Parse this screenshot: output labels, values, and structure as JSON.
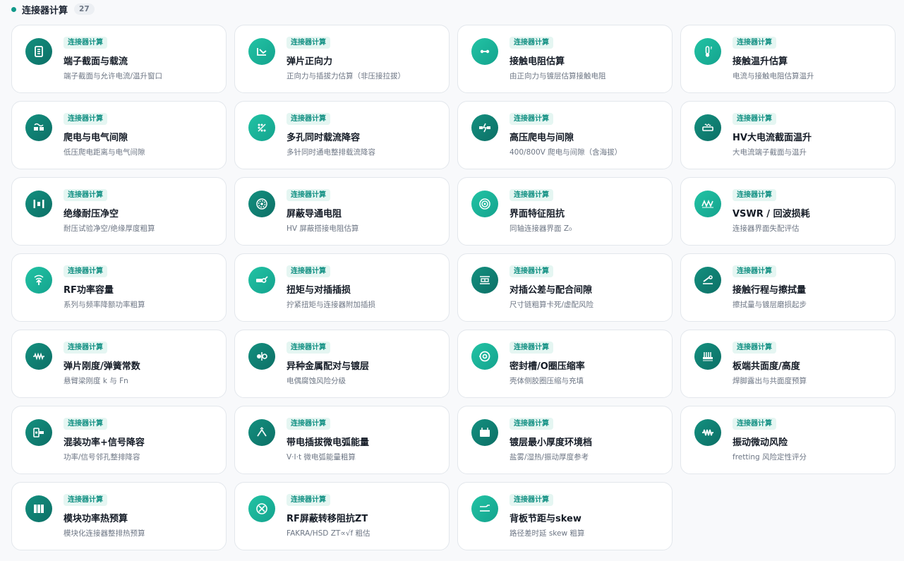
{
  "section": {
    "title": "连接器计算",
    "count": "27"
  },
  "colors": {
    "accent": "#11998a",
    "icon_dark": "#0f7f72",
    "icon_light": "#1db89c",
    "tag_bg": "#e5f6f2",
    "tag_text": "#149184"
  },
  "cards": [
    {
      "tag": "连接器计算",
      "title": "端子截面与载流",
      "desc": "端子截面与允许电流/温升窗口",
      "icon": "terminal-icon"
    },
    {
      "tag": "连接器计算",
      "title": "弹片正向力",
      "desc": "正向力与插拔力估算（非压接拉拔）",
      "icon": "spring-contact-icon"
    },
    {
      "tag": "连接器计算",
      "title": "接触电阻估算",
      "desc": "由正向力与镀层估算接触电阻",
      "icon": "contact-resistance-icon"
    },
    {
      "tag": "连接器计算",
      "title": "接触温升估算",
      "desc": "电流与接触电阻估算温升",
      "icon": "thermometer-icon"
    },
    {
      "tag": "连接器计算",
      "title": "爬电与电气间隙",
      "desc": "低压爬电距离与电气间隙",
      "icon": "creepage-icon"
    },
    {
      "tag": "连接器计算",
      "title": "多孔同时载流降容",
      "desc": "多针同时通电整排载流降容",
      "icon": "multi-pin-icon"
    },
    {
      "tag": "连接器计算",
      "title": "高压爬电与间隙",
      "desc": "400/800V 爬电与间隙（含海拔）",
      "icon": "high-voltage-icon"
    },
    {
      "tag": "连接器计算",
      "title": "HV大电流截面温升",
      "desc": "大电流端子截面与温升",
      "icon": "busbar-icon"
    },
    {
      "tag": "连接器计算",
      "title": "绝缘耐压净空",
      "desc": "耐压试验净空/绝缘厚度粗算",
      "icon": "insulation-icon"
    },
    {
      "tag": "连接器计算",
      "title": "屏蔽导通电阻",
      "desc": "HV 屏蔽搭接电阻估算",
      "icon": "shield-icon"
    },
    {
      "tag": "连接器计算",
      "title": "界面特征阻抗",
      "desc": "同轴连接器界面 Z₀",
      "icon": "coax-icon"
    },
    {
      "tag": "连接器计算",
      "title": "VSWR / 回波损耗",
      "desc": "连接器界面失配评估",
      "icon": "wave-icon"
    },
    {
      "tag": "连接器计算",
      "title": "RF功率容量",
      "desc": "系列与频率降额功率粗算",
      "icon": "rf-power-icon"
    },
    {
      "tag": "连接器计算",
      "title": "扭矩与对插插损",
      "desc": "拧紧扭矩与连接器附加插损",
      "icon": "torque-icon"
    },
    {
      "tag": "连接器计算",
      "title": "对插公差与配合间隙",
      "desc": "尺寸链粗算卡死/虚配风险",
      "icon": "tolerance-icon"
    },
    {
      "tag": "连接器计算",
      "title": "接触行程与擦拭量",
      "desc": "擦拭量与镀层磨损起步",
      "icon": "wipe-icon"
    },
    {
      "tag": "连接器计算",
      "title": "弹片刚度/弹簧常数",
      "desc": "悬臂梁刚度 k 与 Fn",
      "icon": "spring-icon"
    },
    {
      "tag": "连接器计算",
      "title": "异种金属配对与镀层",
      "desc": "电偶腐蚀风险分级",
      "icon": "galvanic-icon"
    },
    {
      "tag": "连接器计算",
      "title": "密封槽/O圈压缩率",
      "desc": "壳体侧胶圈压缩与充填",
      "icon": "o-ring-icon"
    },
    {
      "tag": "连接器计算",
      "title": "板端共面度/高度",
      "desc": "焊脚露出与共面度预算",
      "icon": "coplanarity-icon"
    },
    {
      "tag": "连接器计算",
      "title": "混装功率+信号降容",
      "desc": "功率/信号邻孔整排降容",
      "icon": "hybrid-icon"
    },
    {
      "tag": "连接器计算",
      "title": "带电插拔微电弧能量",
      "desc": "V·I·t 微电弧能量粗算",
      "icon": "arc-icon"
    },
    {
      "tag": "连接器计算",
      "title": "镀层最小厚度环境档",
      "desc": "盐雾/湿热/振动厚度参考",
      "icon": "plating-icon"
    },
    {
      "tag": "连接器计算",
      "title": "振动微动风险",
      "desc": "fretting 风险定性评分",
      "icon": "vibration-icon"
    },
    {
      "tag": "连接器计算",
      "title": "模块功率热预算",
      "desc": "模块化连接器整排热预算",
      "icon": "module-icon"
    },
    {
      "tag": "连接器计算",
      "title": "RF屏蔽转移阻抗ZT",
      "desc": "FAKRA/HSD ZT∝√f 粗估",
      "icon": "transfer-impedance-icon"
    },
    {
      "tag": "连接器计算",
      "title": "背板节距与skew",
      "desc": "路径差时延 skew 粗算",
      "icon": "backplane-icon"
    }
  ]
}
